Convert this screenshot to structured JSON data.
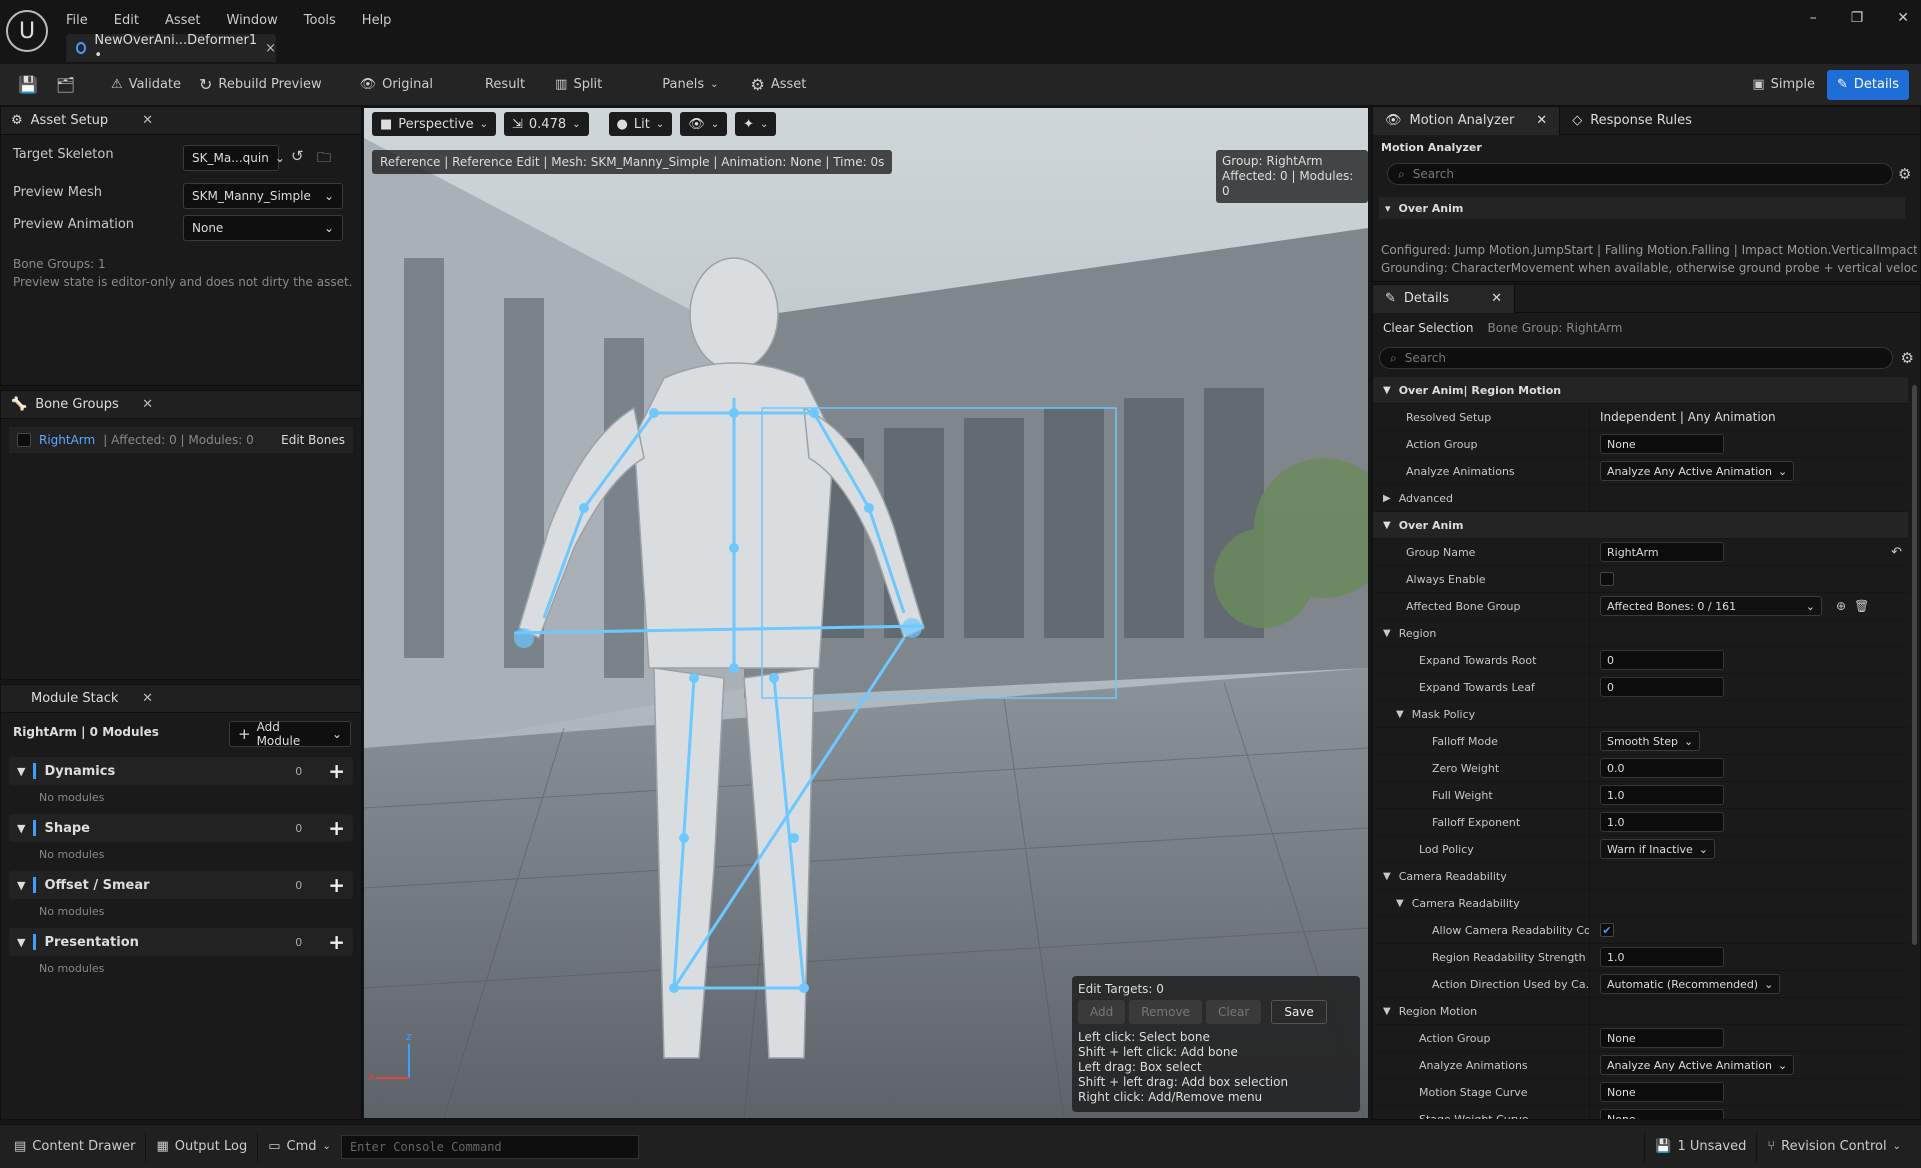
{
  "menu": [
    "File",
    "Edit",
    "Asset",
    "Window",
    "Tools",
    "Help"
  ],
  "doc_tab": {
    "label": "NewOverAni...Deformer1 •",
    "close": "×"
  },
  "window_controls": {
    "minimize": "–",
    "restore": "❐",
    "close": "✕"
  },
  "toolbar": {
    "validate": "Validate",
    "rebuild": "Rebuild Preview",
    "original": "Original",
    "result": "Result",
    "split": "Split",
    "panels": "Panels",
    "asset": "Asset",
    "simple": "Simple",
    "details": "Details"
  },
  "asset_setup": {
    "title": "Asset Setup",
    "target_skeleton_label": "Target Skeleton",
    "target_skeleton_value": "SK_Ma...quin",
    "preview_mesh_label": "Preview Mesh",
    "preview_mesh_value": "SKM_Manny_Simple",
    "preview_anim_label": "Preview Animation",
    "preview_anim_value": "None",
    "bone_groups_info": "Bone Groups: 1",
    "preview_state_note": "Preview state is editor-only and does not dirty the asset."
  },
  "bone_groups": {
    "title": "Bone Groups",
    "row": {
      "name": "RightArm",
      "info": "|  Affected: 0  |  Modules: 0",
      "edit": "Edit Bones"
    }
  },
  "module_stack": {
    "title": "Module Stack",
    "summary": "RightArm  |  0 Modules",
    "add_module": "Add Module",
    "categories": [
      {
        "name": "Dynamics",
        "count": "0",
        "empty": "No modules"
      },
      {
        "name": "Shape",
        "count": "0",
        "empty": "No modules"
      },
      {
        "name": "Offset / Smear",
        "count": "0",
        "empty": "No modules"
      },
      {
        "name": "Presentation",
        "count": "0",
        "empty": "No modules"
      }
    ]
  },
  "viewport": {
    "perspective": "Perspective",
    "fov": "0.478",
    "lit": "Lit",
    "info_bar": "Reference | Reference Edit | Mesh: SKM_Manny_Simple | Animation: None | Time: 0s",
    "group_line1": "Group: RightArm",
    "group_line2": "Affected: 0 | Modules: 0",
    "axis_z": "z",
    "axis_x": "x",
    "edit_targets": "Edit Targets: 0",
    "buttons": {
      "add": "Add",
      "remove": "Remove",
      "clear": "Clear",
      "save": "Save"
    },
    "help": [
      "Left click: Select bone",
      "Shift + left click: Add bone",
      "Left drag: Box select",
      "Shift + left drag: Add box selection",
      "Right click: Add/Remove menu"
    ]
  },
  "motion_analyzer": {
    "tab": "Motion Analyzer",
    "tab2": "Response Rules",
    "header": "Motion Analyzer",
    "search_placeholder": "Search",
    "section": "Over Anim",
    "configured": "Configured: Jump Motion.JumpStart | Falling Motion.Falling | Impact Motion.VerticalImpact | S",
    "grounding": "Grounding: CharacterMovement when available, otherwise ground probe + vertical velocity th"
  },
  "details": {
    "tab": "Details",
    "clear_selection": "Clear Selection",
    "bone_group": "Bone Group: RightArm",
    "search_placeholder": "Search",
    "rows": [
      {
        "k": "sec",
        "label": "Over Anim| Region Motion",
        "indent": 0
      },
      {
        "k": "text",
        "label": "Resolved Setup",
        "value": "Independent | Any Animation",
        "indent": 1
      },
      {
        "k": "inp",
        "label": "Action Group",
        "value": "None",
        "indent": 1
      },
      {
        "k": "dd",
        "label": "Analyze Animations",
        "value": "Analyze Any Active Animation",
        "indent": 1
      },
      {
        "k": "collapsed",
        "label": "Advanced",
        "indent": 0
      },
      {
        "k": "sec",
        "label": "Over Anim",
        "indent": 0
      },
      {
        "k": "inp",
        "label": "Group Name",
        "value": "RightArm",
        "indent": 1
      },
      {
        "k": "chk",
        "label": "Always Enable",
        "value": "",
        "indent": 1
      },
      {
        "k": "ddwide",
        "label": "Affected Bone Group",
        "value": "Affected Bones: 0 / 161",
        "indent": 1
      },
      {
        "k": "grp",
        "label": "Region",
        "indent": 0
      },
      {
        "k": "inp",
        "label": "Expand Towards Root",
        "value": "0",
        "indent": 2
      },
      {
        "k": "inp",
        "label": "Expand Towards Leaf",
        "value": "0",
        "indent": 2
      },
      {
        "k": "grp",
        "label": "Mask Policy",
        "indent": 1
      },
      {
        "k": "dd",
        "label": "Falloff Mode",
        "value": "Smooth Step",
        "indent": 3
      },
      {
        "k": "inp",
        "label": "Zero Weight",
        "value": "0.0",
        "indent": 3
      },
      {
        "k": "inp",
        "label": "Full Weight",
        "value": "1.0",
        "indent": 3
      },
      {
        "k": "inp",
        "label": "Falloff Exponent",
        "value": "1.0",
        "indent": 3
      },
      {
        "k": "dd",
        "label": "Lod Policy",
        "value": "Warn if Inactive",
        "indent": 2
      },
      {
        "k": "grp",
        "label": "Camera Readability",
        "indent": 0
      },
      {
        "k": "grp",
        "label": "Camera Readability",
        "indent": 1
      },
      {
        "k": "chk",
        "label": "Allow Camera Readability Co...",
        "value": "✔",
        "indent": 3
      },
      {
        "k": "inp",
        "label": "Region Readability Strength",
        "value": "1.0",
        "indent": 3
      },
      {
        "k": "dd",
        "label": "Action Direction Used by Ca...",
        "value": "Automatic (Recommended)",
        "indent": 3
      },
      {
        "k": "grp",
        "label": "Region Motion",
        "indent": 0
      },
      {
        "k": "inp",
        "label": "Action Group",
        "value": "None",
        "indent": 2
      },
      {
        "k": "dd",
        "label": "Analyze Animations",
        "value": "Analyze Any Active Animation",
        "indent": 2
      },
      {
        "k": "inp",
        "label": "Motion Stage Curve",
        "value": "None",
        "indent": 2
      },
      {
        "k": "inp",
        "label": "Stage Weight Curve",
        "value": "None",
        "indent": 2
      }
    ]
  },
  "statusbar": {
    "content_drawer": "Content Drawer",
    "output_log": "Output Log",
    "cmd": "Cmd",
    "console_placeholder": "Enter Console Command",
    "unsaved": "1 Unsaved",
    "revision": "Revision Control"
  }
}
